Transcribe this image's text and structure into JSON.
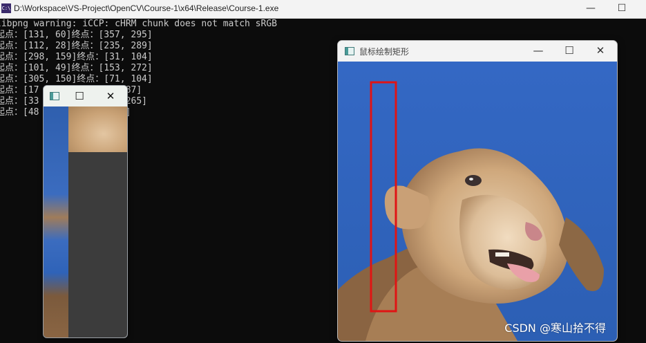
{
  "console": {
    "title": "D:\\Workspace\\VS-Project\\OpenCV\\Course-1\\x64\\Release\\Course-1.exe",
    "icon_text": "C:\\",
    "controls": {
      "minimize": "—",
      "maximize": "☐"
    },
    "lines": [
      "libpng warning: iCCP: cHRM chunk does not match sRGB",
      "起点：[131, 60]终点：[357, 295]",
      "起点：[112, 28]终点：[235, 289]",
      "起点：[298, 159]终点：[31, 104]",
      "起点：[101, 49]终点：[153, 272]",
      "起点：[305, 150]终点：[71, 104]",
      "起点：[17            3, 287]",
      "起点：[33            48, 265]",
      "起点：[48             362]"
    ]
  },
  "small_window": {
    "icon": "window-app-icon",
    "controls": {
      "maximize": "☐",
      "close": "✕"
    }
  },
  "main_window": {
    "title": "鼠标绘制矩形",
    "icon": "window-app-icon",
    "controls": {
      "minimize": "—",
      "maximize": "☐",
      "close": "✕"
    },
    "watermark": "CSDN @寒山拾不得",
    "rect_color": "#e01414"
  }
}
